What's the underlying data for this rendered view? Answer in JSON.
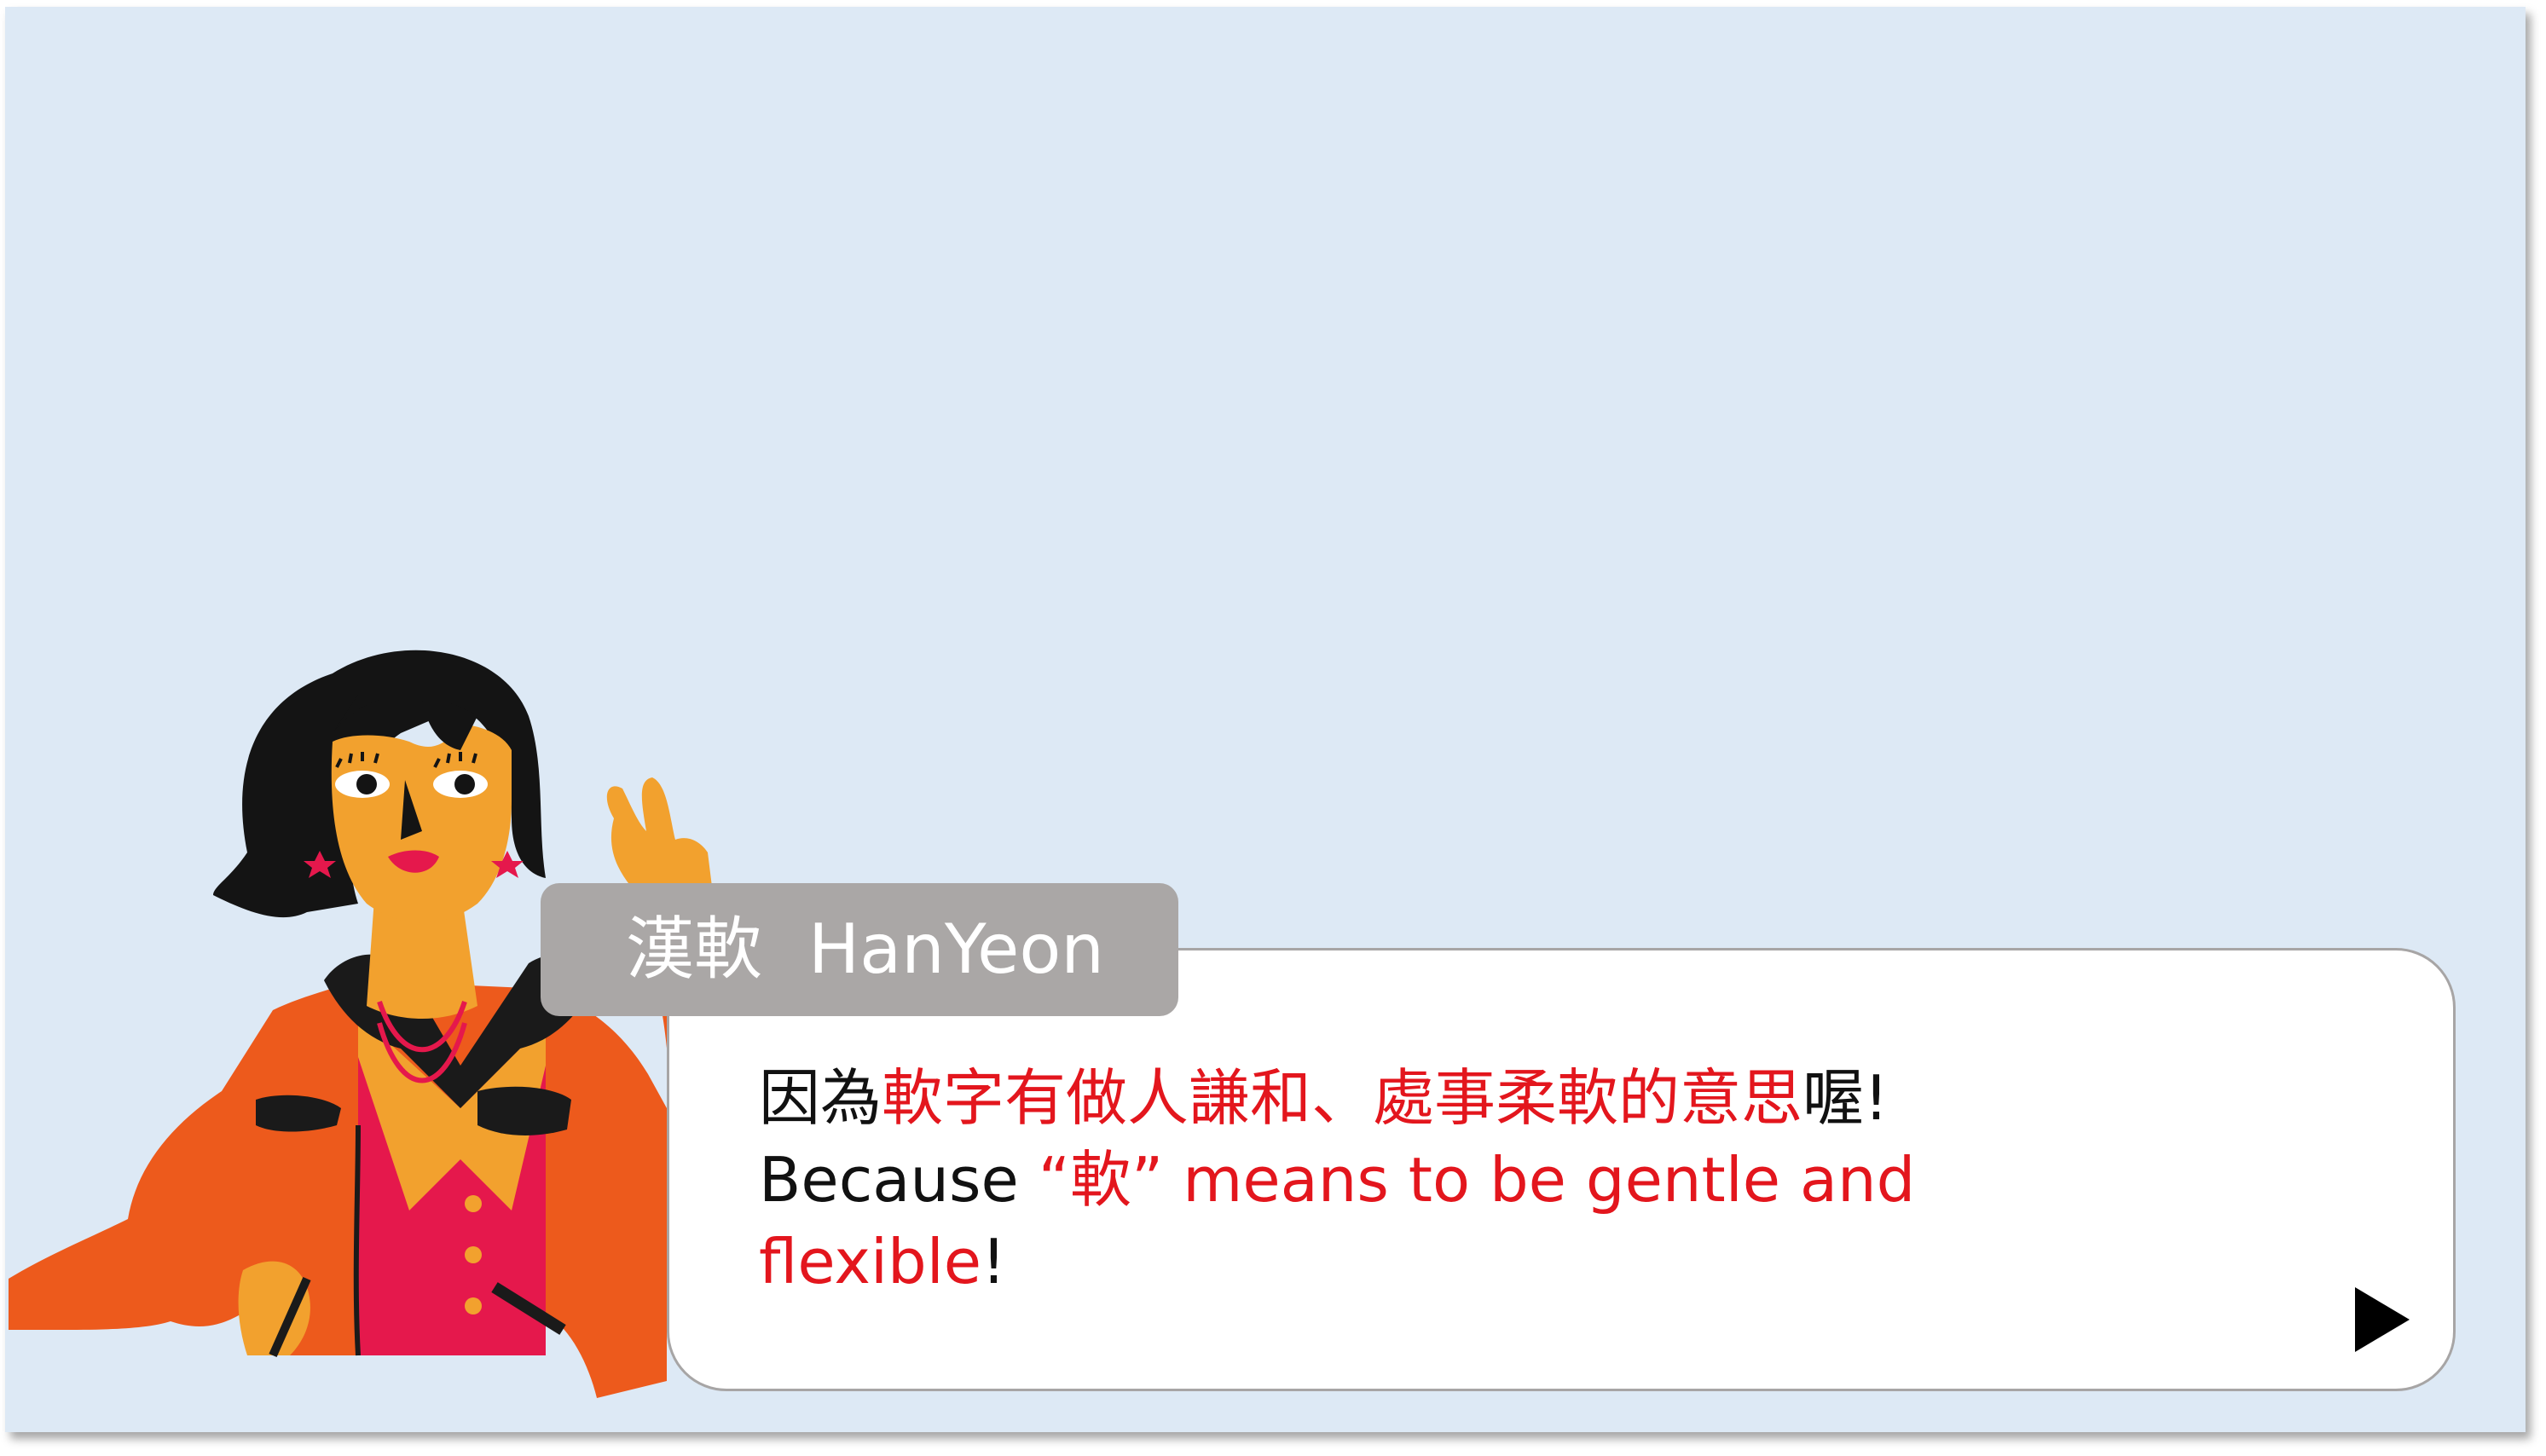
{
  "speaker": {
    "name_zh": "漢軟",
    "name_en": "HanYeon"
  },
  "dialog": {
    "line1": {
      "pre": "因為",
      "highlight": "軟字有做人謙和、處事柔軟的意思",
      "post": "喔!"
    },
    "line2": {
      "pre": "Because ",
      "highlight": "“軟” means to be gentle and"
    },
    "line3": {
      "highlight": "flexible",
      "post": "!"
    }
  },
  "controls": {
    "next_icon": "play-triangle-icon"
  },
  "colors": {
    "background": "#dde9f5",
    "highlight": "#e3161d",
    "name_tag": "#aaa7a6",
    "dialog_border": "#a7a5a5"
  }
}
